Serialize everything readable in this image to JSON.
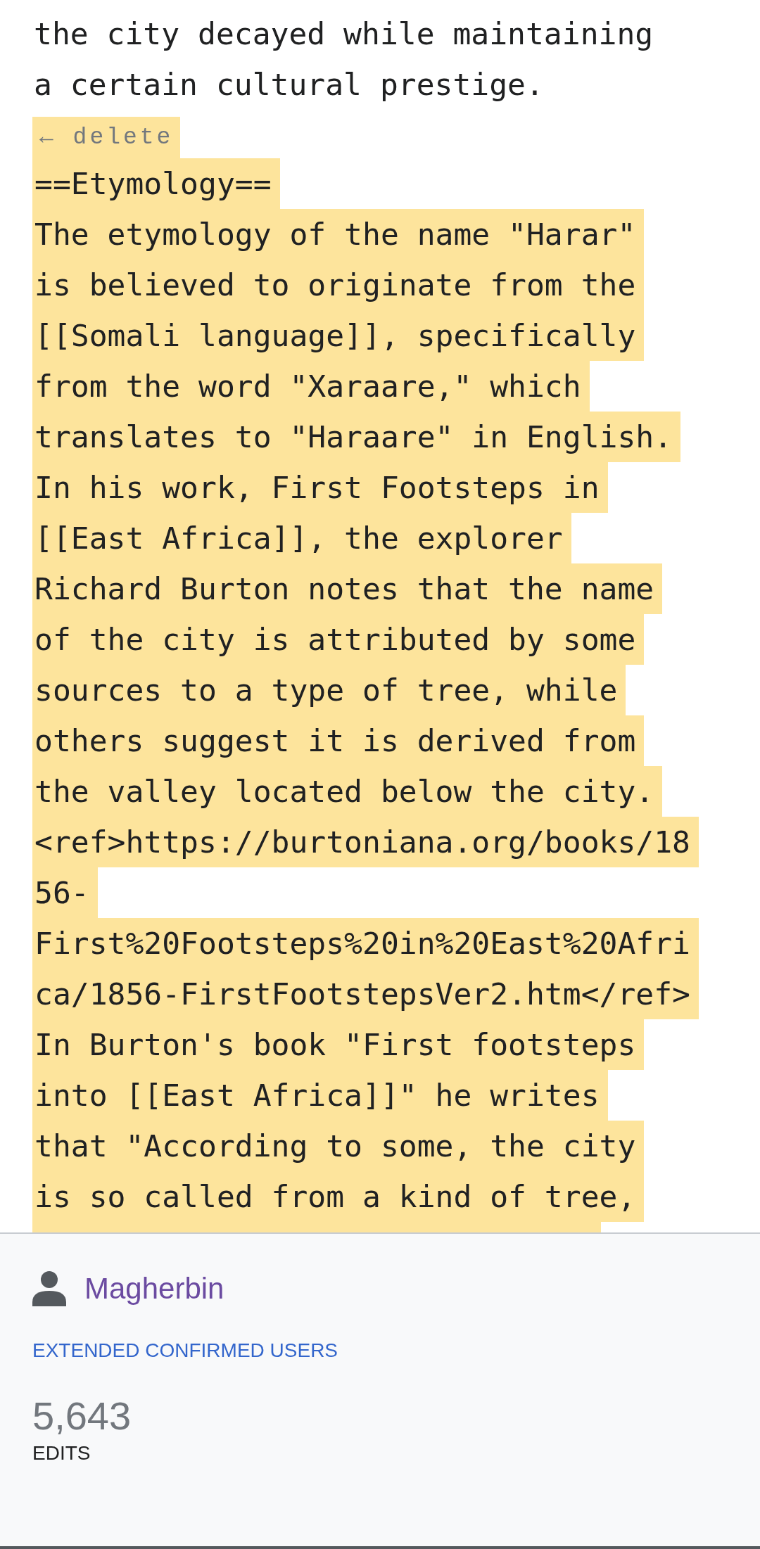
{
  "context_lines": [
    "the city decayed while maintaining",
    "a certain cultural prestige."
  ],
  "deleted_block": {
    "label": "← delete",
    "lines": [
      "==Etymology==",
      "The etymology of the name \"Harar\"",
      "is believed to originate from the",
      "[[Somali language]], specifically",
      "from the word \"Xaraare,\" which",
      "translates to \"Haraare\" in English.",
      "In his work, First Footsteps in",
      "[[East Africa]], the explorer",
      "Richard Burton notes that the name",
      "of the city is attributed by some",
      "sources to a type of tree, while",
      "others suggest it is derived from",
      "the valley located below the city.",
      "<ref>https://burtoniana.org/books/18",
      "56-",
      "First%20Footsteps%20in%20East%20Afri",
      "ca/1856-FirstFootstepsVer2.htm</ref>",
      "In Burton's book \"First footsteps",
      "into [[East Africa]]\" he writes",
      "that \"According to some, the city",
      "is so called from a kind of tree,"
    ]
  },
  "footer": {
    "user": "Magherbin",
    "group": "EXTENDED CONFIRMED USERS",
    "edit_count": "5,643",
    "edit_label": "EDITS"
  }
}
